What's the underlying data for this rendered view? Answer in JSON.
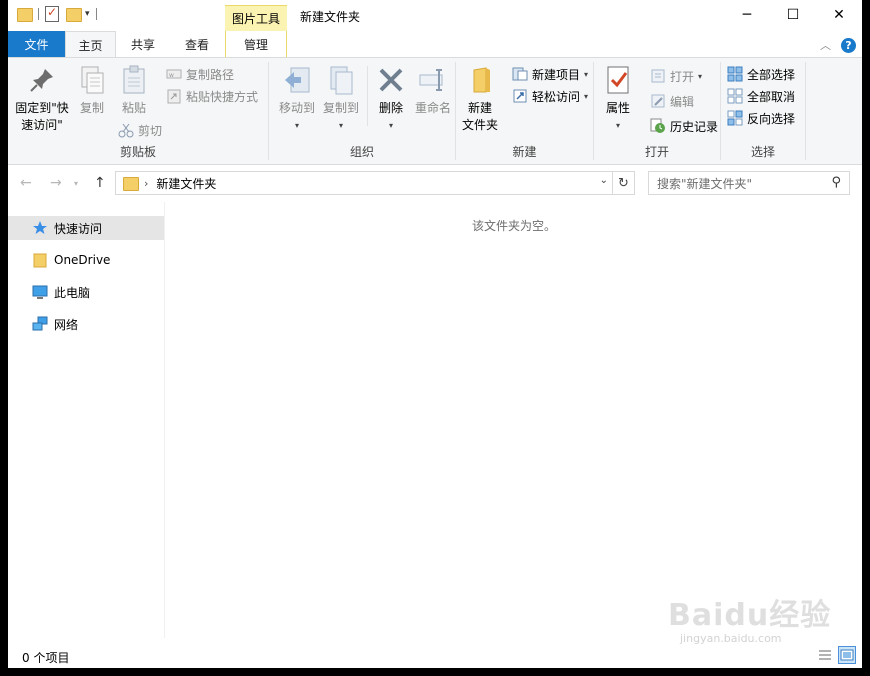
{
  "titlebar": {
    "contextual_tab_label": "图片工具",
    "window_title": "新建文件夹",
    "minimize_label": "─",
    "maximize_label": "☐",
    "close_label": "✕"
  },
  "tabs": {
    "file": "文件",
    "home": "主页",
    "share": "共享",
    "view": "查看",
    "manage": "管理"
  },
  "ribbon": {
    "clipboard": {
      "label": "剪贴板",
      "pin_line1": "固定到\"快",
      "pin_line2": "速访问\"",
      "copy": "复制",
      "paste": "粘贴",
      "copy_path": "复制路径",
      "paste_shortcut": "粘贴快捷方式",
      "cut": "剪切"
    },
    "organize": {
      "label": "组织",
      "move_to": "移动到",
      "copy_to": "复制到",
      "delete": "删除",
      "rename": "重命名"
    },
    "new": {
      "label": "新建",
      "new_folder_line1": "新建",
      "new_folder_line2": "文件夹",
      "new_item": "新建项目",
      "easy_access": "轻松访问"
    },
    "open": {
      "label": "打开",
      "properties": "属性",
      "open": "打开",
      "edit": "编辑",
      "history": "历史记录"
    },
    "select": {
      "label": "选择",
      "select_all": "全部选择",
      "select_none": "全部取消",
      "invert": "反向选择"
    }
  },
  "address": {
    "path": "新建文件夹",
    "search_placeholder": "搜索\"新建文件夹\""
  },
  "navpane": {
    "items": [
      {
        "label": "快速访问",
        "icon": "star-icon"
      },
      {
        "label": "OneDrive",
        "icon": "folder-icon"
      },
      {
        "label": "此电脑",
        "icon": "computer-icon"
      },
      {
        "label": "网络",
        "icon": "network-icon"
      }
    ]
  },
  "content": {
    "empty_message": "该文件夹为空。"
  },
  "status": {
    "item_count": "0 个项目"
  },
  "watermark": {
    "text": "Baidu经验",
    "url": "jingyan.baidu.com"
  },
  "colors": {
    "accent": "#1979ca",
    "contextual": "#fbf3b2",
    "ribbon_bg": "#f5f6f7"
  }
}
